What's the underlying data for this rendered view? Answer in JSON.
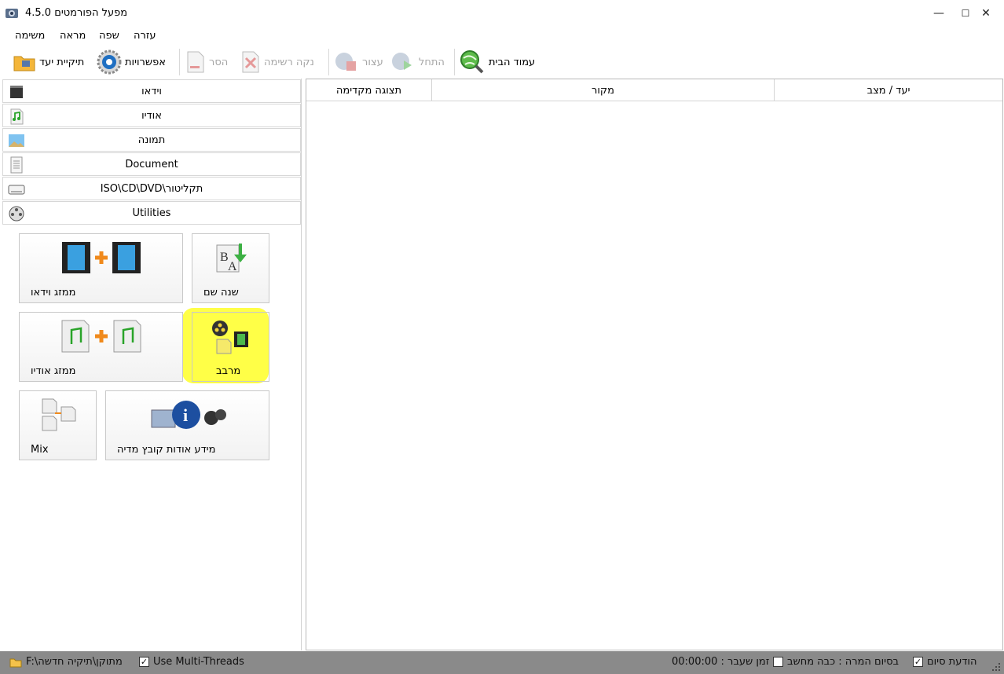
{
  "window": {
    "title": "מפעל הפורמטים 4.5.0",
    "min": "—",
    "max": "☐",
    "close": "✕"
  },
  "menu": [
    "עזרה",
    "שפה",
    "מראה",
    "משימה"
  ],
  "toolbar": {
    "home": "עמוד הבית",
    "start": "התחל",
    "stop": "עצור",
    "clear": "נקה רשימה",
    "remove": "הסר",
    "options": "אפשרויות",
    "output_folder": "תיקיית יעד"
  },
  "columns": {
    "dest_status": "יעד / מצב",
    "source": "מקור",
    "preview": "תצוגה מקדימה"
  },
  "categories": [
    "וידאו",
    "אודיו",
    "תמונה",
    "Document",
    "ISO\\CD\\DVD\\תקליטור",
    "Utilities"
  ],
  "tiles": {
    "video_joiner": "ממזג וידאו",
    "rename": "שנה שם",
    "audio_joiner": "ממזג אודיו",
    "mux": "מרבב",
    "mix": "Mix",
    "media_info": "מידע אודות קובץ מדיה"
  },
  "status": {
    "output_path": "F:\\מתוקן\\תיקיה חדשה",
    "multithreads": "Use Multi-Threads",
    "shutdown": "בסיום המרה : כבה מחשב",
    "notify": "הודעת סיום",
    "elapsed": "00:00:00 : זמן שעבר"
  }
}
